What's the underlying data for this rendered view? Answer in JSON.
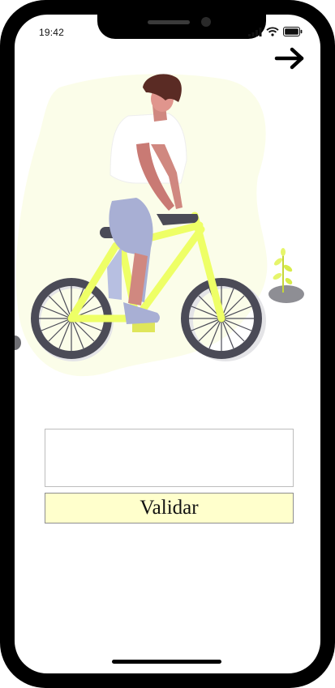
{
  "status_bar": {
    "time": "19:42",
    "icons": [
      "signal-icon",
      "wifi-icon",
      "battery-icon"
    ]
  },
  "header": {
    "next_icon": "arrow-right-icon"
  },
  "illustration": {
    "name": "person-riding-bicycle-illustration",
    "accent_color": "#eeff66"
  },
  "form": {
    "input_value": "",
    "input_placeholder": "",
    "validate_label": "Validar",
    "button_color": "#ffffcc"
  }
}
